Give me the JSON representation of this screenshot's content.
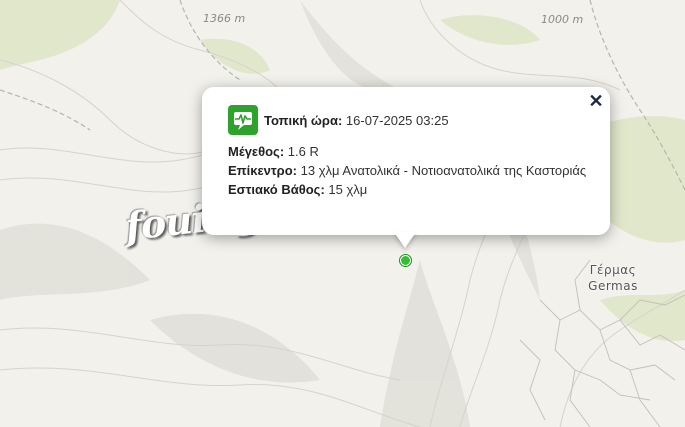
{
  "map": {
    "contour_labels": [
      "1366 m",
      "1000 m"
    ],
    "town": {
      "name_greek": "Γέρμας",
      "name_latin": "Germas"
    },
    "watermark": "fouit.gr",
    "colors": {
      "terrain": "#f2f1ec",
      "vegetation": "#dfe6c8",
      "contour": "#d8d3c9",
      "marker": "#2fbf2f",
      "popup_close": "#1e2a44"
    }
  },
  "popup": {
    "icon": "seismograph-icon",
    "local_time_label": "Τοπική ώρα:",
    "local_time_value": "16-07-2025 03:25",
    "magnitude_label": "Μέγεθος:",
    "magnitude_value": "1.6 R",
    "epicenter_label": "Επίκεντρο:",
    "epicenter_value": "13 χλμ Ανατολικά - Νοτιοανατολικά της Καστοριάς",
    "depth_label": "Εστιακό Βάθος:",
    "depth_value": "15 χλμ",
    "close_symbol": "✕"
  }
}
